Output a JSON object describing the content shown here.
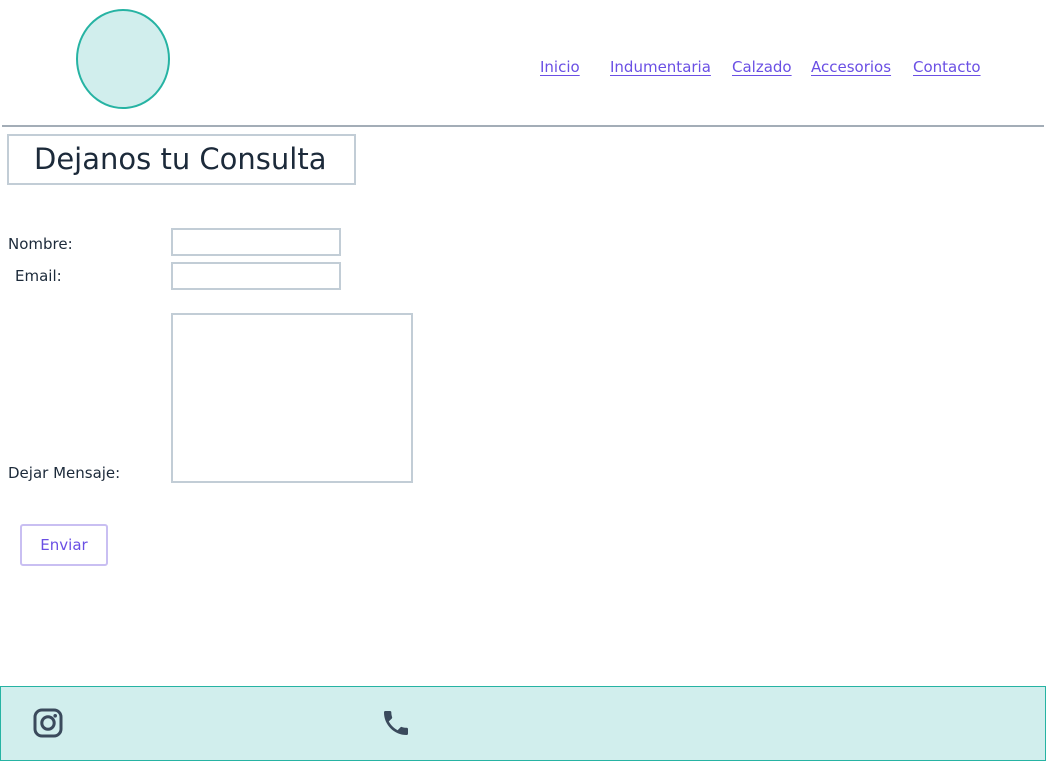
{
  "header": {
    "nav": [
      {
        "label": "Inicio"
      },
      {
        "label": "Indumentaria"
      },
      {
        "label": "Calzado"
      },
      {
        "label": "Accesorios"
      },
      {
        "label": "Contacto"
      }
    ]
  },
  "form": {
    "title": "Dejanos tu Consulta",
    "name_label": "Nombre:",
    "name_value": "",
    "email_label": "Email:",
    "email_value": "",
    "message_label": "Dejar Mensaje:",
    "message_value": "",
    "submit_label": "Enviar"
  },
  "footer": {
    "icons": [
      "instagram-icon",
      "phone-icon"
    ]
  },
  "colors": {
    "accent": "#6a4fe4",
    "teal": "#26b3a3",
    "mint": "#d1eeed",
    "border": "#c2cdd6",
    "divider": "#a3adb7",
    "icon": "#3a4a5c"
  }
}
